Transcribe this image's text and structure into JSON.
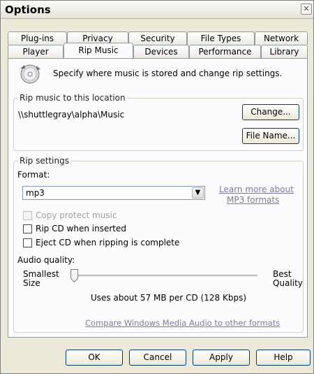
{
  "window": {
    "title": "Options",
    "close_glyph": "✕"
  },
  "tabs_back": [
    "Plug-ins",
    "Privacy",
    "Security",
    "File Types",
    "Network"
  ],
  "tabs_front": [
    "Player",
    "Rip Music",
    "Devices",
    "Performance",
    "Library"
  ],
  "active_tab": "Rip Music",
  "header": {
    "text": "Specify where music is stored and change rip settings.",
    "icon": "cd-rip-icon"
  },
  "location": {
    "group_label": "Rip music to this location",
    "path": "\\\\shuttlegray\\alpha\\Music",
    "change_button": "Change...",
    "filename_button": "File Name..."
  },
  "rip_settings": {
    "group_label": "Rip settings",
    "format_label": "Format:",
    "format_value": "mp3",
    "learn_more_line1": "Learn more about",
    "learn_more_line2": "MP3 formats",
    "copy_protect": {
      "label": "Copy protect music",
      "checked": false,
      "disabled": true
    },
    "rip_when_inserted": {
      "label": "Rip CD when inserted",
      "checked": false
    },
    "eject_when_complete": {
      "label": "Eject CD when ripping is complete",
      "checked": false
    },
    "quality_label": "Audio quality:",
    "smallest_line1": "Smallest",
    "smallest_line2": "Size",
    "best_line1": "Best",
    "best_line2": "Quality",
    "quality_level": 0.0,
    "usage_text": "Uses about 57 MB per CD (128 Kbps)",
    "compare_link": "Compare Windows Media Audio to other formats"
  },
  "footer": {
    "ok": "OK",
    "cancel": "Cancel",
    "apply": "Apply",
    "help": "Help"
  }
}
